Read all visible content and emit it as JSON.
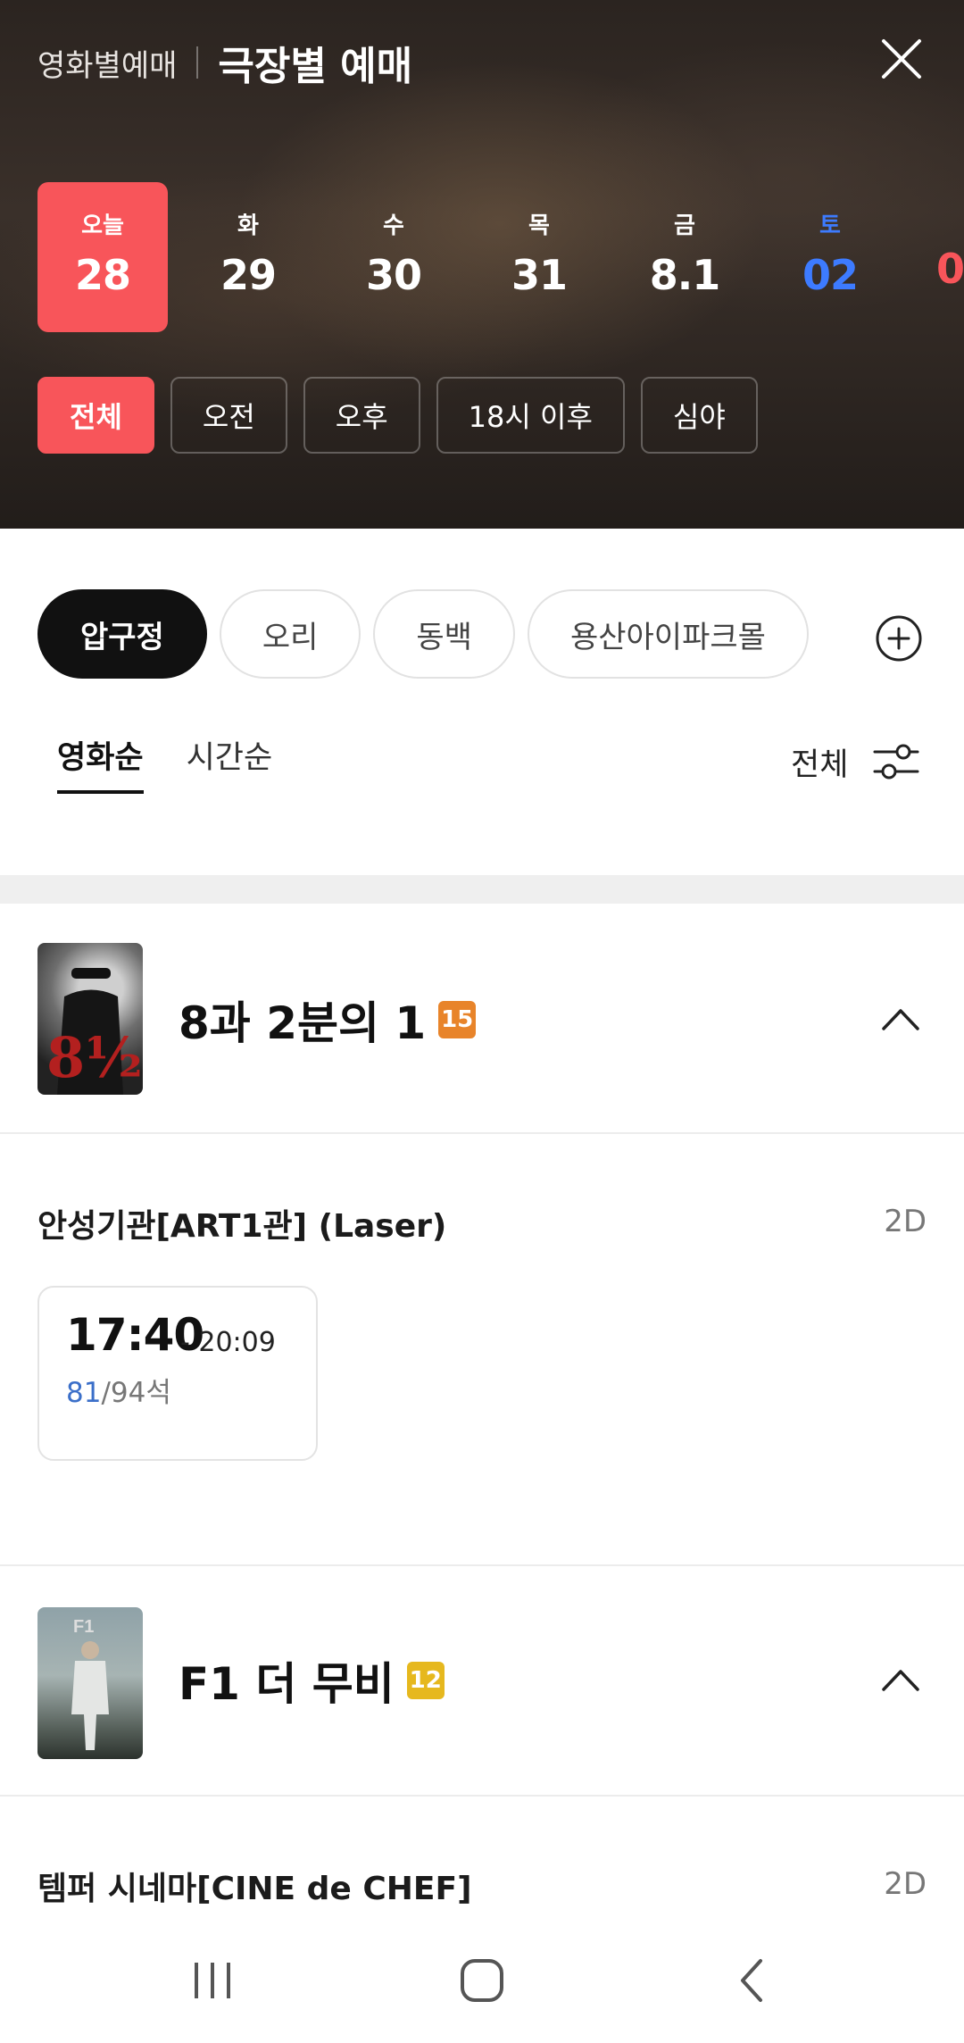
{
  "header": {
    "tab_movie": "영화별예매",
    "tab_theater": "극장별 예매"
  },
  "dates": [
    {
      "dow": "오늘",
      "num": "28",
      "state": "active"
    },
    {
      "dow": "화",
      "num": "29",
      "state": ""
    },
    {
      "dow": "수",
      "num": "30",
      "state": ""
    },
    {
      "dow": "목",
      "num": "31",
      "state": ""
    },
    {
      "dow": "금",
      "num": "8.1",
      "state": ""
    },
    {
      "dow": "토",
      "num": "02",
      "state": "sat"
    },
    {
      "dow": "",
      "num": "0",
      "state": "sun"
    }
  ],
  "time_filters": [
    "전체",
    "오전",
    "오후",
    "18시 이후",
    "심야"
  ],
  "theaters": [
    "압구정",
    "오리",
    "동백",
    "용산아이파크몰"
  ],
  "sort": {
    "by_movie": "영화순",
    "by_time": "시간순",
    "filter_label": "전체"
  },
  "movies": [
    {
      "title": "8과 2분의 1",
      "rating": "15",
      "rating_color": "#e8842a",
      "hall": "안성기관[ART1관] (Laser)",
      "format": "2D",
      "showtime": {
        "start": "17:40",
        "end": "- 20:09",
        "available": "81",
        "total": "/94석"
      }
    },
    {
      "title": "F1 더 무비",
      "rating": "12",
      "rating_color": "#e6b81e",
      "hall": "템퍼 시네마[CINE de CHEF]",
      "format": "2D"
    }
  ],
  "icons": {
    "close": "close-icon",
    "add": "plus-circle-icon",
    "filter": "filter-sliders-icon",
    "collapse": "chevron-up-icon",
    "nav_recent": "recent-apps-icon",
    "nav_home": "home-icon",
    "nav_back": "back-icon"
  },
  "colors": {
    "accent": "#f8555a",
    "saturday": "#3d7bff",
    "seat_available": "#3b6fc9"
  }
}
